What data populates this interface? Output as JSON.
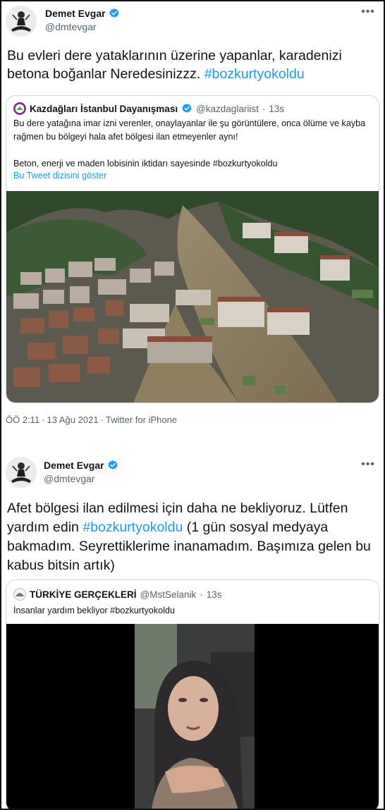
{
  "tweets": [
    {
      "author": {
        "name": "Demet Evgar",
        "handle": "@dmtevgar"
      },
      "text_plain": "Bu evleri dere yataklarının üzerine yapanlar, karadenizi betona boğanlar  Neredesinizzz. ",
      "hashtag": "#bozkurtyokoldu",
      "quote": {
        "name": "Kazdağları İstanbul Dayanışması",
        "handle": "@kazdaglariist",
        "sep": "·",
        "time": "13s",
        "line1": "Bu dere yatağına imar izni verenler, onaylayanlar ile şu görüntülere, onca ölüme ve kayba rağmen bu bölgeyi hala afet bölgesi ilan etmeyenler aynı!",
        "line2": "Beton, enerji ve maden lobisinin iktidarı sayesinde #bozkurtyokoldu",
        "show_thread": "Bu Tweet dizisini göster",
        "media": "aerial-flood-photo"
      },
      "timestamp": "ÖÖ 2:11",
      "date": "13 Ağu 2021",
      "dot": "·",
      "source": "Twitter for iPhone"
    },
    {
      "author": {
        "name": "Demet Evgar",
        "handle": "@dmtevgar"
      },
      "text_before": "Afet bölgesi ilan edilmesi için daha ne bekliyoruz. Lütfen yardım edin ",
      "hashtag": "#bozkurtyokoldu",
      "text_after": "  (1 gün sosyal medyaya bakmadım. Seyrettiklerime inanamadım. Başımıza gelen bu kabus bitsin artık)",
      "quote": {
        "name": "TÜRKİYE GERÇEKLERİ",
        "handle": "@MstSelanik",
        "sep": "·",
        "time": "13s",
        "line1": "İnsanlar yardım bekliyor #bozkurtyokoldu",
        "media": "woman-in-car-video"
      }
    }
  ],
  "icons": {
    "verified": "verified-badge-icon",
    "more": "more-options-icon"
  },
  "colors": {
    "link": "#1d9bf0",
    "secondary_text": "#536471",
    "border": "#cfd9de",
    "verified": "#1d9bf0"
  }
}
